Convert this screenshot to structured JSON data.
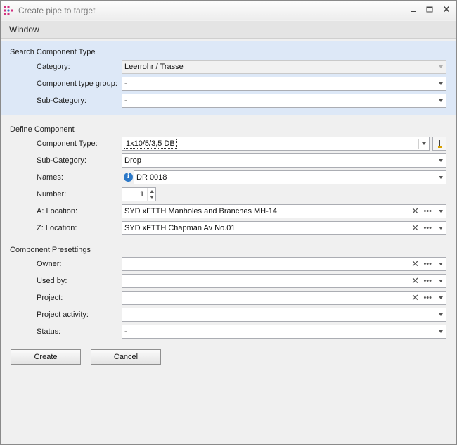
{
  "window": {
    "title": "Create pipe to target"
  },
  "menu": {
    "items": [
      "Window"
    ]
  },
  "search": {
    "title": "Search Component Type",
    "category": {
      "label": "Category:",
      "value": "Leerrohr / Trasse"
    },
    "type_group": {
      "label": "Component type group:",
      "value": "-"
    },
    "subcategory": {
      "label": "Sub-Category:",
      "value": "-"
    }
  },
  "define": {
    "title": "Define Component",
    "component_type": {
      "label": "Component Type:",
      "value": "1x10/5/3,5 DB"
    },
    "subcategory": {
      "label": "Sub-Category:",
      "value": "Drop"
    },
    "names": {
      "label": "Names:",
      "value": "DR 0018"
    },
    "number": {
      "label": "Number:",
      "value": "1"
    },
    "a_location": {
      "label": "A: Location:",
      "value": "SYD xFTTH Manholes and Branches MH-14"
    },
    "z_location": {
      "label": "Z: Location:",
      "value": "SYD xFTTH Chapman Av No.01"
    }
  },
  "presettings": {
    "title": "Component Presettings",
    "owner": {
      "label": "Owner:",
      "value": ""
    },
    "used_by": {
      "label": "Used by:",
      "value": ""
    },
    "project": {
      "label": "Project:",
      "value": ""
    },
    "project_activity": {
      "label": "Project activity:",
      "value": ""
    },
    "status": {
      "label": "Status:",
      "value": "-"
    }
  },
  "buttons": {
    "create": "Create",
    "cancel": "Cancel"
  },
  "colors": {
    "search_panel": "#dde8f7",
    "info_icon": "#2b78c8"
  },
  "icons": [
    "app-icon",
    "minimize-icon",
    "maximize-icon",
    "close-icon",
    "info-icon",
    "pin-icon",
    "clear-icon",
    "ellipsis-icon",
    "dropdown-icon"
  ]
}
